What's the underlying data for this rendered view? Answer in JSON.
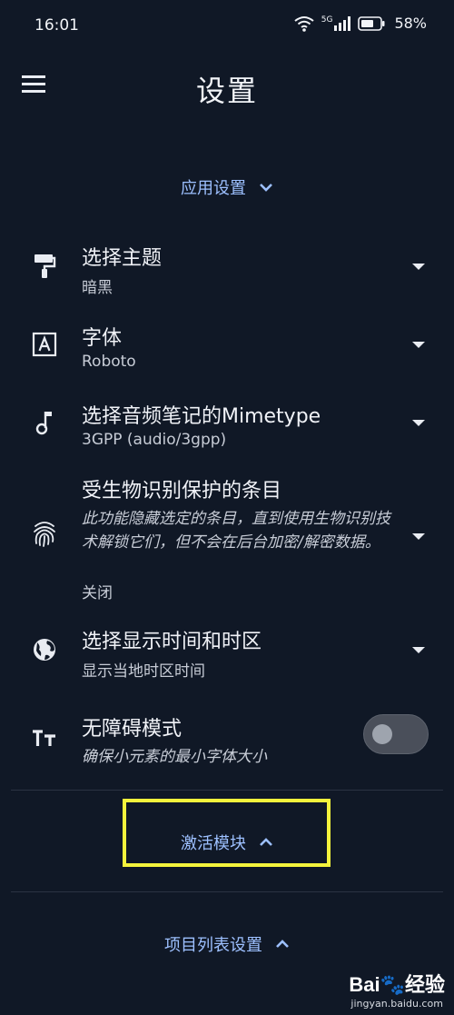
{
  "status_bar": {
    "time": "16:01",
    "battery": "58%",
    "network": "5G"
  },
  "app_bar": {
    "title": "设置",
    "menu_icon": "menu-icon"
  },
  "sections": {
    "app_settings": {
      "label": "应用设置",
      "icon": "chevron-down-icon"
    },
    "activate_modules": {
      "label": "激活模块",
      "icon": "chevron-up-icon"
    },
    "item_list_settings": {
      "label": "项目列表设置",
      "icon": "chevron-up-icon"
    }
  },
  "settings": {
    "theme": {
      "title": "选择主题",
      "value": "暗黑",
      "icon": "paint-roller-icon"
    },
    "font": {
      "title": "字体",
      "value": "Roboto",
      "icon": "font-icon"
    },
    "audio_mimetype": {
      "title": "选择音频笔记的Mimetype",
      "value": "3GPP (audio/3gpp)",
      "icon": "music-note-icon"
    },
    "biometric": {
      "title": "受生物识别保护的条目",
      "description": "此功能隐藏选定的条目，直到使用生物识别技术解锁它们，但不会在后台加密/解密数据。",
      "value": "关闭",
      "icon": "fingerprint-icon"
    },
    "timezone": {
      "title": "选择显示时间和时区",
      "value": "显示当地时区时间",
      "icon": "globe-icon"
    },
    "accessibility": {
      "title": "无障碍模式",
      "description": "确保小元素的最小字体大小",
      "enabled": false,
      "icon": "text-size-icon"
    }
  },
  "watermark": {
    "brand": "Bai🐾经验",
    "url": "jingyan.baidu.com"
  },
  "colors": {
    "background": "#101826",
    "accent": "#9dc0ff",
    "highlight": "#f4f33c"
  }
}
